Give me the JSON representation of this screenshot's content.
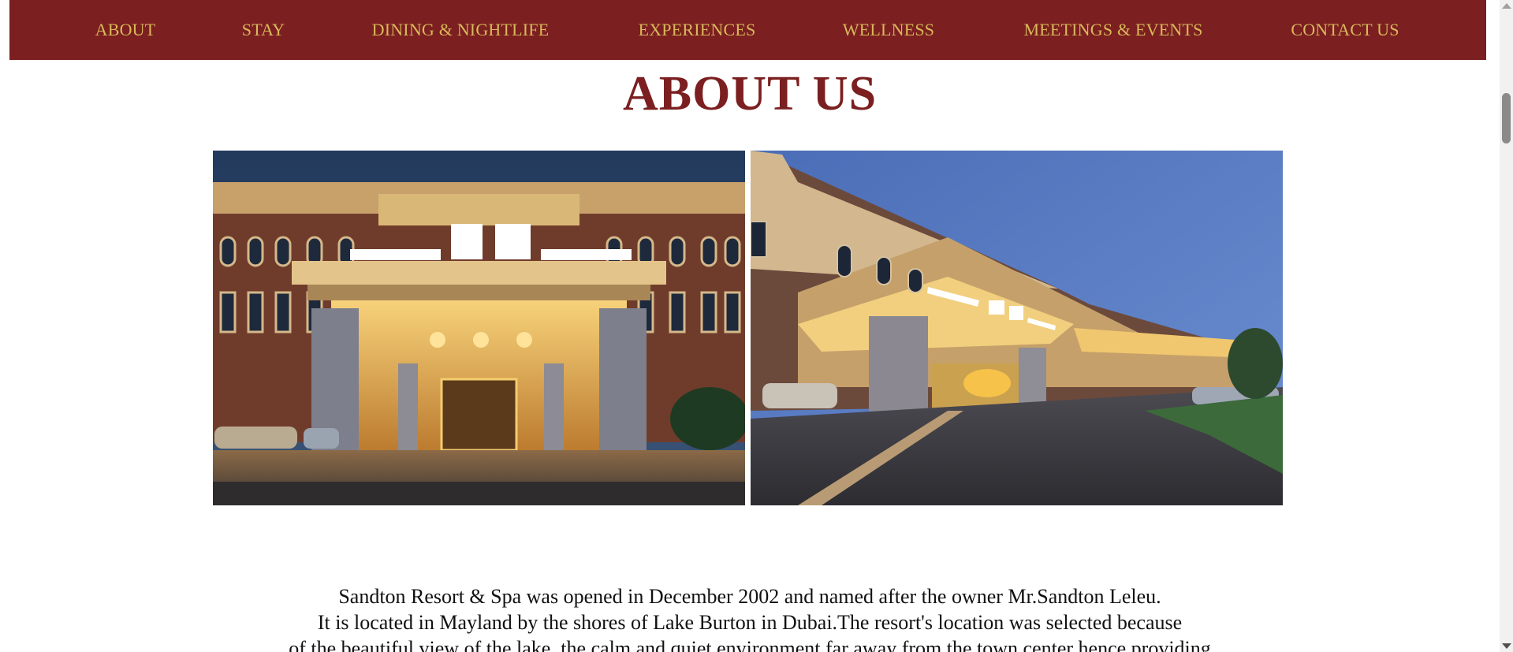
{
  "nav": {
    "items": [
      {
        "label": "ABOUT"
      },
      {
        "label": "STAY"
      },
      {
        "label": "DINING & NIGHTLIFE"
      },
      {
        "label": "EXPERIENCES"
      },
      {
        "label": "WELLNESS"
      },
      {
        "label": "MEETINGS & EVENTS"
      },
      {
        "label": "CONTACT US"
      }
    ]
  },
  "main": {
    "title": "ABOUT US",
    "images": [
      {
        "icon": "hotel-entrance-front-photo"
      },
      {
        "icon": "hotel-entrance-side-photo"
      }
    ],
    "paragraph": [
      "Sandton Resort & Spa was opened in December 2002 and named after the owner Mr.Sandton Leleu.",
      "It is located in Mayland by the shores of Lake Burton in Dubai.The resort's location was selected because",
      "of the beautiful view of the lake, the calm and quiet environment far away from the town center hence providing"
    ]
  },
  "colors": {
    "nav_bg": "#7b1f20",
    "nav_text": "#d8b95a",
    "title": "#7b1f20"
  }
}
